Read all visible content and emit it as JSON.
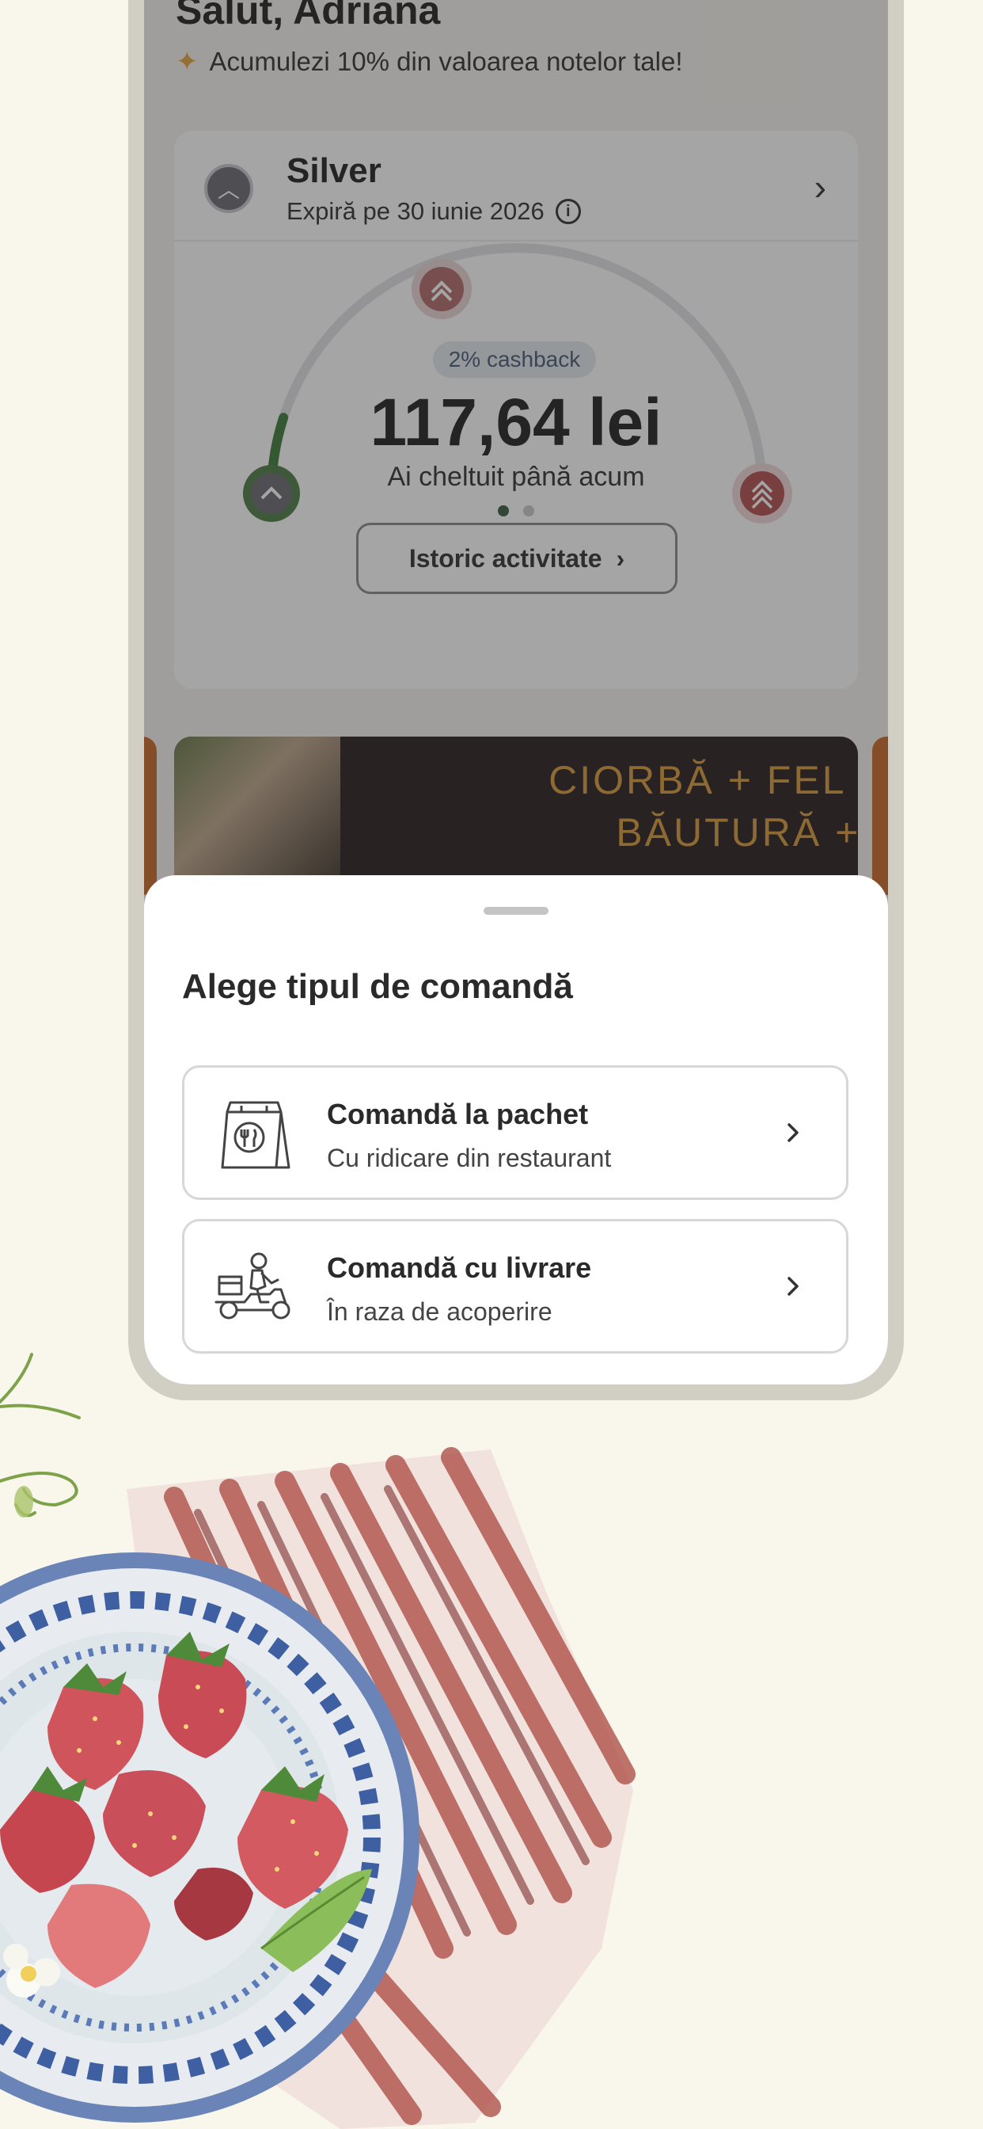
{
  "home": {
    "greeting": "Salut, Adriana",
    "promo_text": "Acumulezi 10% din valoarea notelor tale!",
    "loyalty": {
      "tier_name": "Silver",
      "expiry": "Expiră pe 30 iunie 2026",
      "cashback_badge": "2% cashback",
      "amount_spent": "117,64 lei",
      "spent_label": "Ai cheltuit până acum",
      "progress_fraction": 0.1,
      "history_button": "Istoric activitate"
    },
    "banner": {
      "line1": "CIORBĂ + FEL PRIN",
      "line2": "BĂUTURĂ + DES"
    }
  },
  "sheet": {
    "title": "Alege tipul de comandă",
    "options": [
      {
        "title": "Comandă la pachet",
        "subtitle": "Cu ridicare din restaurant",
        "icon": "takeaway-bag-icon"
      },
      {
        "title": "Comandă cu livrare",
        "subtitle": "În raza de acoperire",
        "icon": "delivery-scooter-icon"
      }
    ]
  },
  "colors": {
    "background": "#f9f6ec",
    "gauge_progress": "#3b7a3a",
    "tier_gold": "#a85a5a",
    "banner_text": "#d69a3c"
  }
}
